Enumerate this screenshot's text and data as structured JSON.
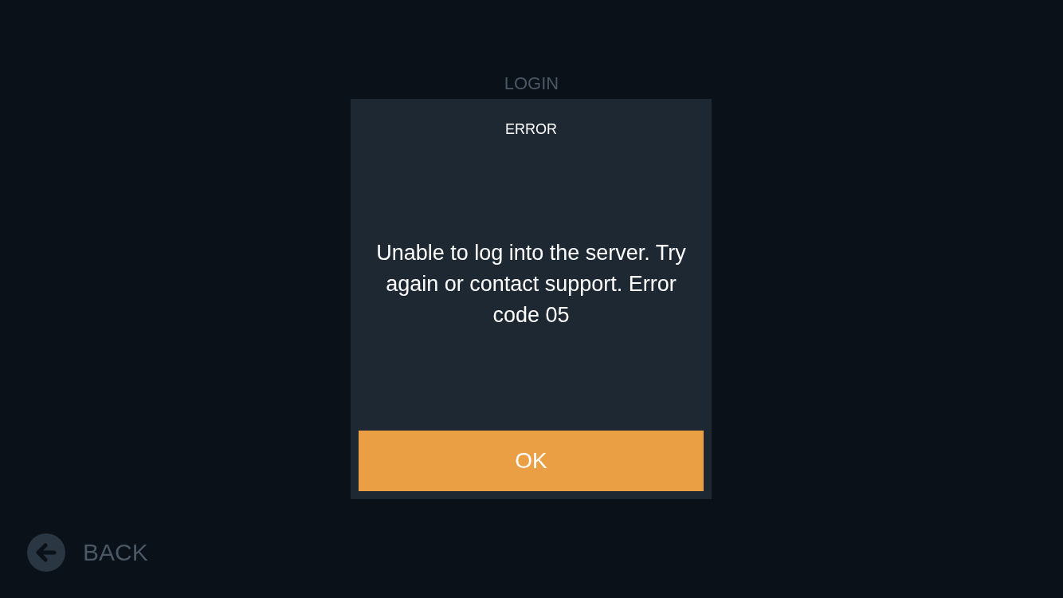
{
  "screen": {
    "title": "LOGIN"
  },
  "back_button": {
    "label": "BACK"
  },
  "dialog": {
    "title": "ERROR",
    "message": "Unable to log into the server. Try again or contact support. Error code 05",
    "button": "OK"
  }
}
